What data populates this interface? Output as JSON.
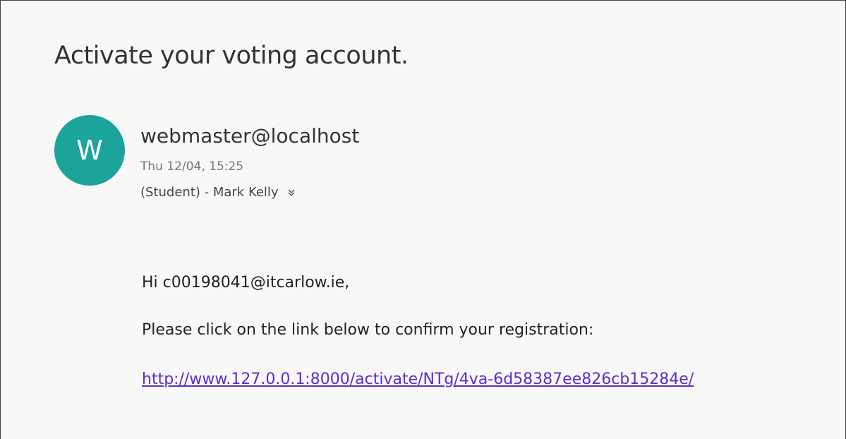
{
  "email": {
    "subject": "Activate your voting account.",
    "avatar": {
      "letter": "W",
      "color": "#1ba39c"
    },
    "sender": "webmaster@localhost",
    "date": "Thu 12/04, 15:25",
    "recipients": "(Student) - Mark Kelly",
    "expand_icon": "chevron-double-down-icon",
    "body": {
      "greeting": "Hi c00198041@itcarlow.ie,",
      "instruction": "Please click on the link below to confirm your registration:",
      "link_text": "http://www.127.0.0.1:8000/activate/NTg/4va-6d58387ee826cb15284e/",
      "link_color": "#5b2fc9"
    }
  }
}
